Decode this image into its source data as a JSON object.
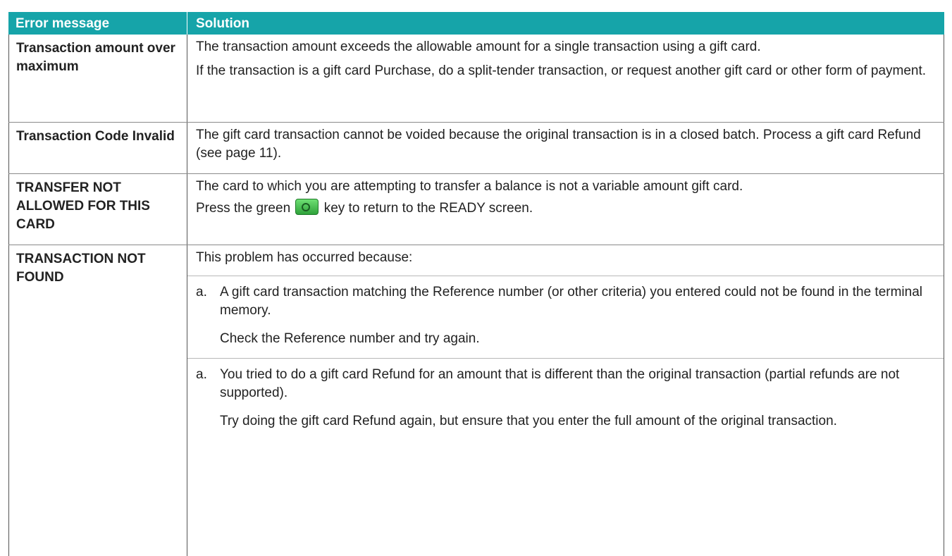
{
  "table": {
    "header": {
      "col1": "Error message",
      "col2": "Solution"
    },
    "rows": [
      {
        "error": "Transaction amount over maximum",
        "p1": "The transaction amount exceeds the allowable amount for a single transaction using a gift card.",
        "p2": "If the transaction is a gift card Purchase, do a split-tender transaction, or request another gift card or other form of payment."
      },
      {
        "error": "Transaction Code Invalid",
        "p1": "The gift card transaction cannot be voided because the original transaction is in a closed batch.  Process a gift card Refund (see page 11)."
      },
      {
        "error": "TRANSFER NOT ALLOWED FOR THIS CARD",
        "p1": "The card to which you are attempting to transfer a balance is not a variable amount gift card.",
        "p2_before": "Press the green",
        "key_icon": "green-key-icon",
        "p2_after": "key to return to the READY screen."
      },
      {
        "error": "TRANSACTION NOT FOUND",
        "intro": "This problem has occurred because:",
        "items": [
          {
            "label": "a.",
            "text": "A gift card transaction matching the Reference number (or other criteria) you entered could not be found in the terminal memory.",
            "followup": "Check the Reference number and try again."
          },
          {
            "label": "a.",
            "text": "You tried to do a gift card Refund for an amount that is different than the original transaction (partial refunds are not supported).",
            "followup": "Try doing the gift card Refund again, but ensure that you enter the full amount of the original transaction."
          }
        ]
      }
    ]
  }
}
